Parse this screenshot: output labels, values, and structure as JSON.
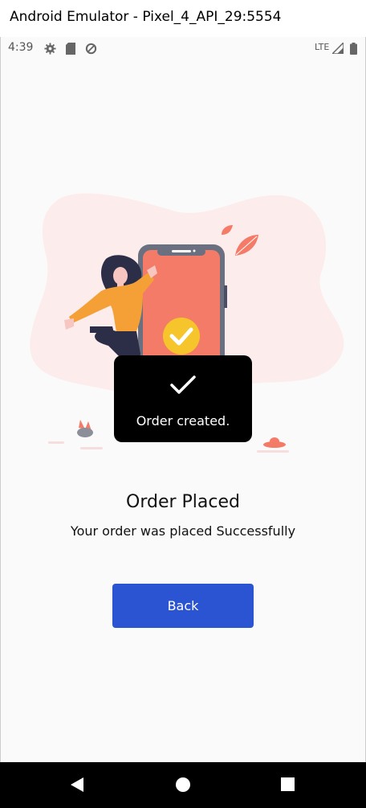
{
  "window": {
    "title": "Android Emulator - Pixel_4_API_29:5554"
  },
  "status_bar": {
    "time": "4:39",
    "network": "LTE",
    "icons": [
      "settings-icon",
      "sd-card-icon",
      "data-saver-icon",
      "signal-icon",
      "battery-icon"
    ]
  },
  "toast": {
    "icon": "check-icon",
    "message": "Order created."
  },
  "main": {
    "title": "Order Placed",
    "subtitle": "Your order was placed Successfully",
    "back_label": "Back"
  },
  "nav": {
    "icons": [
      "back-icon",
      "home-icon",
      "recents-icon"
    ]
  },
  "colors": {
    "accent": "#2b54d2",
    "illustration": "#f47b67",
    "check_badge": "#f5c52b",
    "blob": "#fdecec"
  }
}
